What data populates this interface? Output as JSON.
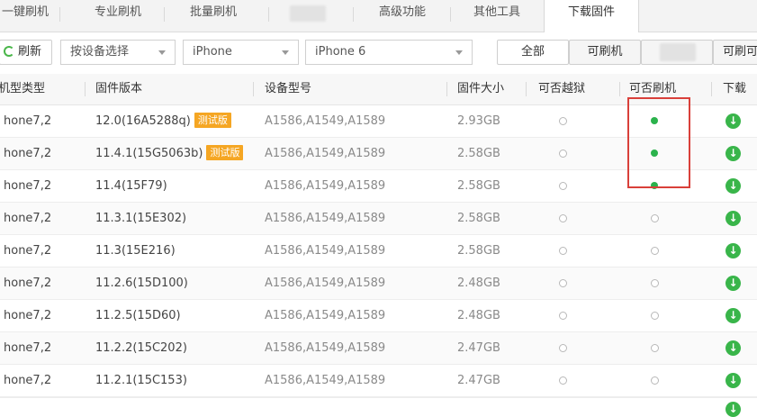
{
  "tabs": [
    {
      "label": "一键刷机",
      "active": false
    },
    {
      "label": "专业刷机",
      "active": false
    },
    {
      "label": "批量刷机",
      "active": false
    },
    {
      "label": "",
      "active": false
    },
    {
      "label": "高级功能",
      "active": false
    },
    {
      "label": "其他工具",
      "active": false
    },
    {
      "label": "下载固件",
      "active": true
    }
  ],
  "toolbar": {
    "refresh_label": "刷新",
    "device_select": "按设备选择",
    "model_select": "iPhone",
    "submodel_select": "iPhone 6",
    "filter_all": "全部",
    "filter_flashable": "可刷机",
    "filter_third": "可刷可"
  },
  "table": {
    "columns": [
      "机型类型",
      "固件版本",
      "设备型号",
      "固件大小",
      "可否越狱",
      "可否刷机",
      "下载"
    ],
    "beta_label": "测试版",
    "rows": [
      {
        "type": "hone7,2",
        "version": "12.0(16A5288q)",
        "beta": true,
        "models": "A1586,A1549,A1589",
        "size": "2.93GB",
        "jailbreak": false,
        "flashable": true
      },
      {
        "type": "hone7,2",
        "version": "11.4.1(15G5063b)",
        "beta": true,
        "models": "A1586,A1549,A1589",
        "size": "2.58GB",
        "jailbreak": false,
        "flashable": true
      },
      {
        "type": "hone7,2",
        "version": "11.4(15F79)",
        "beta": false,
        "models": "A1586,A1549,A1589",
        "size": "2.58GB",
        "jailbreak": false,
        "flashable": true
      },
      {
        "type": "hone7,2",
        "version": "11.3.1(15E302)",
        "beta": false,
        "models": "A1586,A1549,A1589",
        "size": "2.58GB",
        "jailbreak": false,
        "flashable": false
      },
      {
        "type": "hone7,2",
        "version": "11.3(15E216)",
        "beta": false,
        "models": "A1586,A1549,A1589",
        "size": "2.58GB",
        "jailbreak": false,
        "flashable": false
      },
      {
        "type": "hone7,2",
        "version": "11.2.6(15D100)",
        "beta": false,
        "models": "A1586,A1549,A1589",
        "size": "2.48GB",
        "jailbreak": false,
        "flashable": false
      },
      {
        "type": "hone7,2",
        "version": "11.2.5(15D60)",
        "beta": false,
        "models": "A1586,A1549,A1589",
        "size": "2.48GB",
        "jailbreak": false,
        "flashable": false
      },
      {
        "type": "hone7,2",
        "version": "11.2.2(15C202)",
        "beta": false,
        "models": "A1586,A1549,A1589",
        "size": "2.47GB",
        "jailbreak": false,
        "flashable": false
      },
      {
        "type": "hone7,2",
        "version": "11.2.1(15C153)",
        "beta": false,
        "models": "A1586,A1549,A1589",
        "size": "2.47GB",
        "jailbreak": false,
        "flashable": false
      }
    ]
  },
  "colors": {
    "accent_green": "#39b54a",
    "beta_orange": "#f5a623",
    "highlight_red": "#d9403a"
  }
}
